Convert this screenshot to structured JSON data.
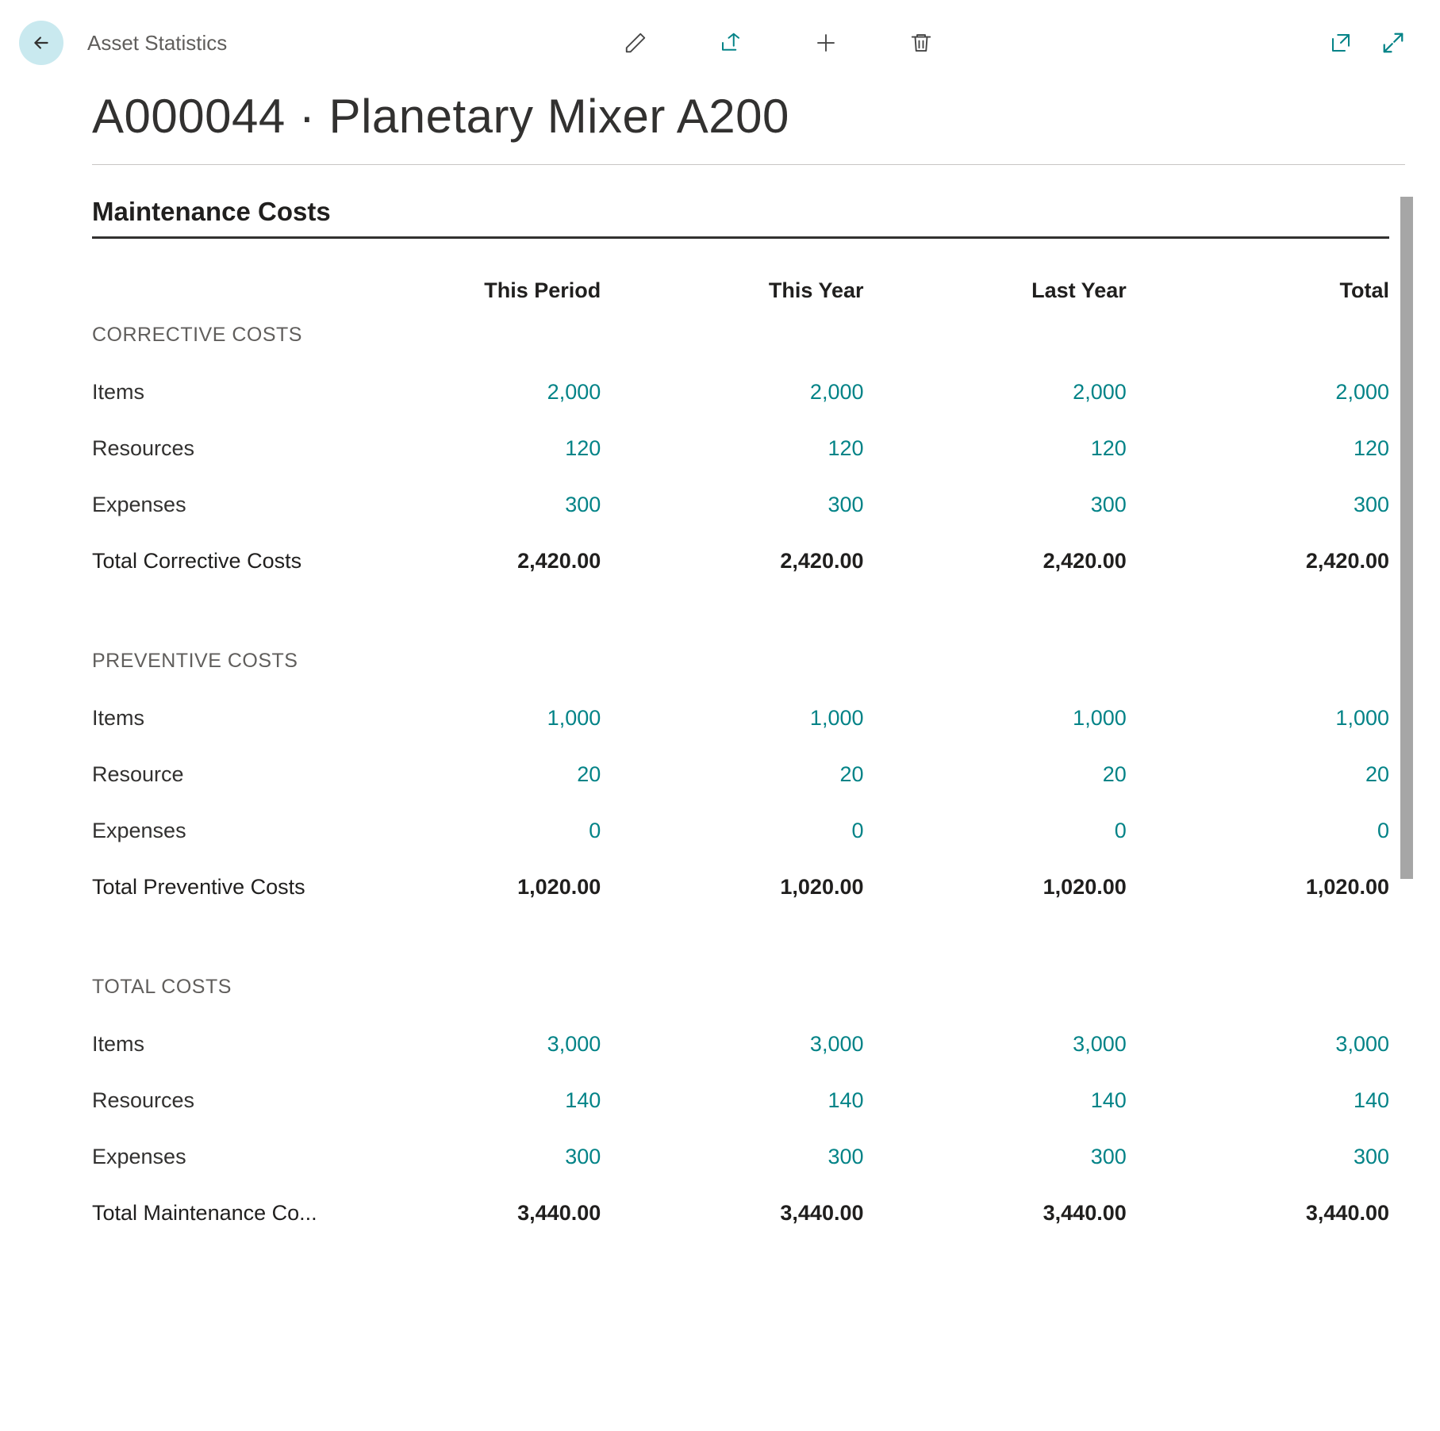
{
  "header": {
    "breadcrumb": "Asset Statistics",
    "title": "A000044 · Planetary Mixer A200"
  },
  "section": {
    "title": "Maintenance Costs"
  },
  "columns": [
    "This Period",
    "This Year",
    "Last Year",
    "Total"
  ],
  "groups": [
    {
      "name": "CORRECTIVE COSTS",
      "rows": [
        {
          "label": "Items",
          "values": [
            "2,000",
            "2,000",
            "2,000",
            "2,000"
          ]
        },
        {
          "label": "Resources",
          "values": [
            "120",
            "120",
            "120",
            "120"
          ]
        },
        {
          "label": "Expenses",
          "values": [
            "300",
            "300",
            "300",
            "300"
          ]
        }
      ],
      "total": {
        "label": "Total Corrective Costs",
        "values": [
          "2,420.00",
          "2,420.00",
          "2,420.00",
          "2,420.00"
        ]
      }
    },
    {
      "name": "PREVENTIVE COSTS",
      "rows": [
        {
          "label": "Items",
          "values": [
            "1,000",
            "1,000",
            "1,000",
            "1,000"
          ]
        },
        {
          "label": "Resource",
          "values": [
            "20",
            "20",
            "20",
            "20"
          ]
        },
        {
          "label": "Expenses",
          "values": [
            "0",
            "0",
            "0",
            "0"
          ]
        }
      ],
      "total": {
        "label": "Total Preventive Costs",
        "values": [
          "1,020.00",
          "1,020.00",
          "1,020.00",
          "1,020.00"
        ]
      }
    },
    {
      "name": "TOTAL COSTS",
      "rows": [
        {
          "label": "Items",
          "values": [
            "3,000",
            "3,000",
            "3,000",
            "3,000"
          ]
        },
        {
          "label": "Resources",
          "values": [
            "140",
            "140",
            "140",
            "140"
          ]
        },
        {
          "label": "Expenses",
          "values": [
            "300",
            "300",
            "300",
            "300"
          ]
        }
      ],
      "total": {
        "label": "Total Maintenance Co...",
        "values": [
          "3,440.00",
          "3,440.00",
          "3,440.00",
          "3,440.00"
        ]
      }
    }
  ],
  "colors": {
    "link": "#038387"
  }
}
